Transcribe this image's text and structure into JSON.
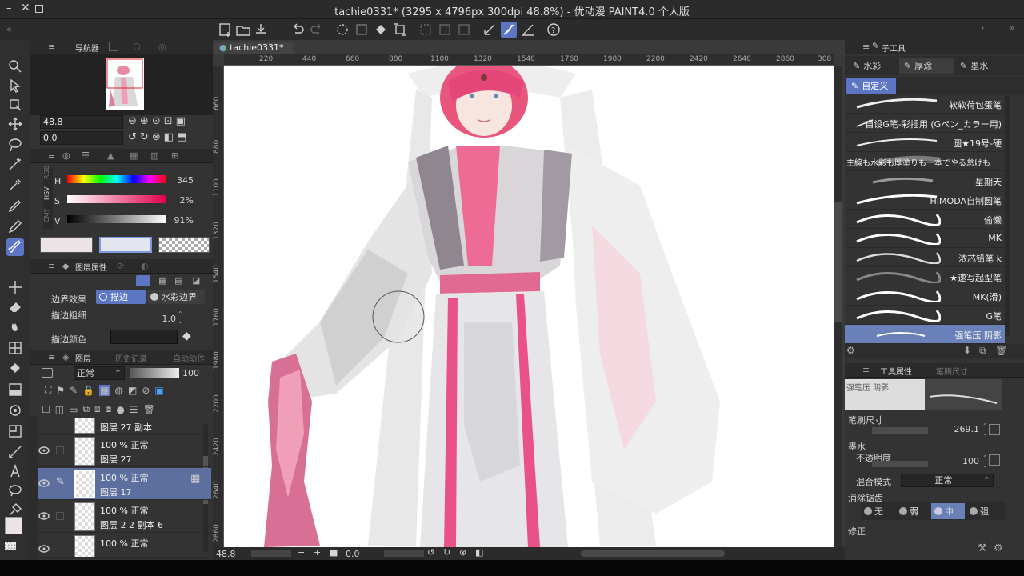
{
  "window": {
    "title": "tachie0331* (3295 x 4796px 300dpi 48.8%) - 优动漫 PAINT4.0 个人版"
  },
  "navigator": {
    "tab": "导航器",
    "zoom": "48.8",
    "rotation": "0.0"
  },
  "color": {
    "mode_tabs": [
      "RGB",
      "HSV",
      "CMY"
    ],
    "h_label": "H",
    "h_value": "345",
    "s_label": "S",
    "s_value": "2%",
    "v_label": "V",
    "v_value": "91%",
    "main_color": "#ebe3e5",
    "sub_color": "#e3e6ee"
  },
  "layer_property": {
    "tab": "图层属性",
    "effect_label": "边界效果",
    "option_stroke": "描边",
    "option_watercolor": "水彩边界",
    "width_label": "描边粗细",
    "width_value": "1.0",
    "color_label": "描边颜色"
  },
  "layers_panel": {
    "tabs": [
      "图层",
      "历史记录",
      "自动动作"
    ],
    "blend_mode": "正常",
    "opacity": "100",
    "rows": [
      {
        "line1": "图层 27 副本",
        "line2": ""
      },
      {
        "line1": "100 % 正常",
        "line2": "图层 27"
      },
      {
        "line1": "100 % 正常",
        "line2": "图层 17"
      },
      {
        "line1": "100 % 正常",
        "line2": "图层 2 2 副本 6"
      },
      {
        "line1": "100 % 正常",
        "line2": ""
      }
    ]
  },
  "canvas": {
    "tab": "tachie0331*",
    "ruler_top": [
      "220",
      "440",
      "660",
      "880",
      "1100",
      "1320",
      "1540",
      "1760",
      "1980",
      "2200",
      "2420",
      "2640",
      "2860",
      "308"
    ],
    "ruler_left": [
      "660",
      "880",
      "1100",
      "1320",
      "1540",
      "1760",
      "1980",
      "2200",
      "2420",
      "2640",
      "2860"
    ],
    "zoom": "48.8",
    "angle": "0.0"
  },
  "subtool": {
    "header": "子工具",
    "tabs": [
      "水彩",
      "厚涂",
      "墨水"
    ],
    "group": "自定义",
    "brushes": [
      "软软荷包蛋笔",
      "自设G笔-彩插用 (Gペン_カラー用)",
      "圆★19号-硬",
      "主線も水彩も厚塗りも一本でやる怠けも",
      "星期天",
      "HIMODA自制圆笔",
      "偷懒",
      "MK",
      "浓芯铅笔 k",
      "★速写起型笔",
      "MK(滑)",
      "G笔",
      "强笔压 阴影"
    ]
  },
  "tool_property": {
    "tabs": [
      "工具属性",
      "笔刷尺寸"
    ],
    "preview_name": "强笔压 阴影",
    "size_label": "笔刷尺寸",
    "size_value": "269.1",
    "ink_label": "墨水",
    "opacity_label": "不透明度",
    "opacity_value": "100",
    "blend_label": "混合模式",
    "blend_value": "正常",
    "aa_label": "消除锯齿",
    "aa_options": [
      "无",
      "弱",
      "中",
      "强"
    ],
    "correction_label": "修正"
  }
}
